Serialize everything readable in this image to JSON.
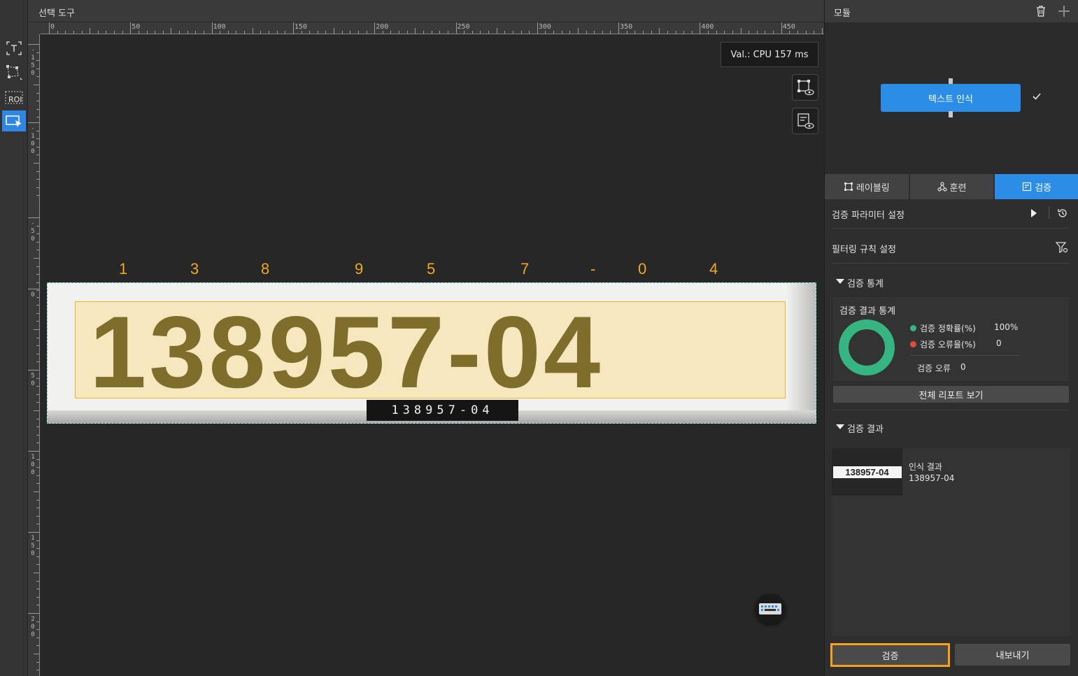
{
  "header": {
    "title": "선택 도구"
  },
  "rulers": {
    "h_labels": [
      "0",
      "50",
      "100",
      "150",
      "200",
      "250",
      "300",
      "350",
      "400",
      "450"
    ],
    "v_labels": [
      "- 1 5 0",
      "- 1 0 0",
      "- 5 0",
      "0",
      "5 0",
      "1 0 0",
      "1 5 0",
      "2 0 0"
    ]
  },
  "toolbar": {
    "items": [
      {
        "icon": "text-box-icon"
      },
      {
        "icon": "polygon-tool-icon"
      },
      {
        "icon": "roi-icon",
        "label": "ROI"
      },
      {
        "icon": "select-tool-icon",
        "active": true
      }
    ]
  },
  "canvas": {
    "perf_badge": "Val.:  CPU 157 ms",
    "char_labels": [
      "1",
      "3",
      "8",
      "9",
      "5",
      "7",
      "-",
      "0",
      "4"
    ],
    "image_text": "138957-04",
    "result_tag": "138957-04",
    "label_color": "#f0a820",
    "roi_color": "#e9b72f"
  },
  "panel": {
    "module_title": "모듈",
    "module_node": "텍스트 인식",
    "tabs": [
      {
        "label": "레이블링",
        "icon": "labeling-icon"
      },
      {
        "label": "훈련",
        "icon": "training-icon"
      },
      {
        "label": "검증",
        "icon": "verify-icon",
        "active": true
      }
    ],
    "param_settings": "검증 파라미터 설정",
    "filter_settings": "필터링 규칙 설정",
    "stats_section": "검증 통계",
    "stats_card_title": "검증 결과 통계",
    "accuracy_label": "검증 정확률(%)",
    "accuracy_value": "100%",
    "error_rate_label": "검증 오류율(%)",
    "error_rate_value": "0",
    "error_count_label": "검증 오류",
    "error_count_value": "0",
    "accuracy_fraction": 1.0,
    "report_button": "전체 리포트 보기",
    "results_section": "검증 결과",
    "result_item": {
      "thumb_text": "138957-04",
      "title": "인식 결과",
      "value": "138957-04"
    },
    "verify_button": "검증",
    "export_button": "내보내기",
    "accent_color": "#2b8de6",
    "success_color": "#36b583",
    "error_color": "#e04b3a"
  }
}
